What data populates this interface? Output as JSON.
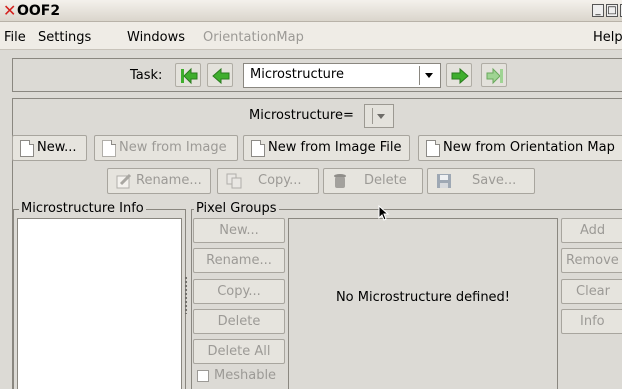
{
  "window": {
    "title": "OOF2",
    "close_glyph": "✕",
    "minimize_glyph": "_",
    "maximize_glyph": "□"
  },
  "menu": {
    "items": [
      "File",
      "Settings",
      "Windows",
      "OrientationMap",
      "Help"
    ]
  },
  "task": {
    "label": "Task:",
    "selected": "Microstructure"
  },
  "microstructure": {
    "label": "Microstructure=",
    "buttons": {
      "new": "New...",
      "new_from_image": "New from Image",
      "new_from_image_file": "New from Image File",
      "new_from_orientation_map": "New from Orientation Map",
      "rename": "Rename...",
      "copy": "Copy...",
      "delete": "Delete",
      "save": "Save..."
    }
  },
  "info": {
    "title": "Microstructure Info"
  },
  "pixel_groups": {
    "title": "Pixel Groups",
    "left_buttons": [
      "New...",
      "Rename...",
      "Copy...",
      "Delete",
      "Delete All"
    ],
    "meshable": "Meshable",
    "message": "No Microstructure defined!",
    "right_buttons": [
      "Add",
      "Remove",
      "Clear",
      "Info"
    ]
  },
  "colors": {
    "background": "#dcdad5",
    "title_x": "#d4201c",
    "disabled_text": "#9c9a96",
    "arrow_green": "#3fae2e"
  }
}
